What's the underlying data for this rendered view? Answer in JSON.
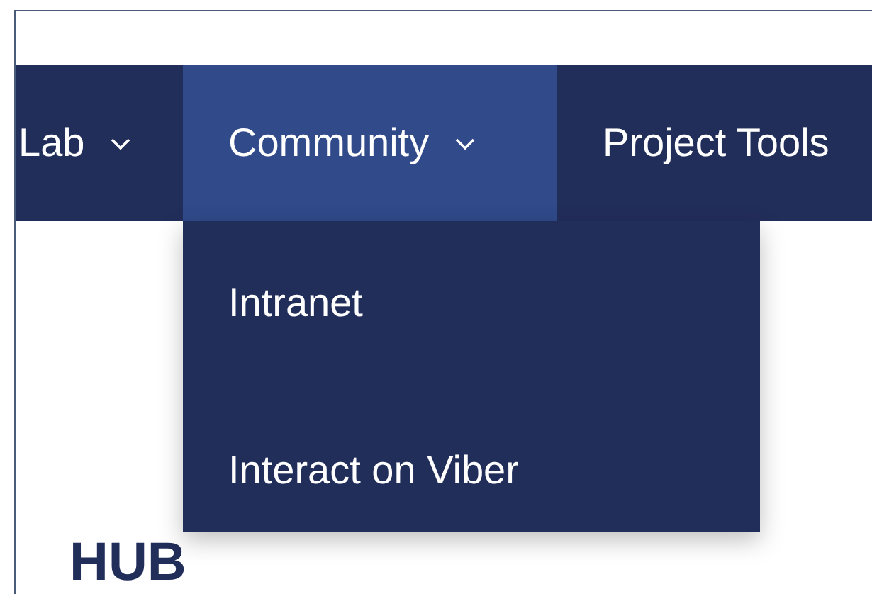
{
  "nav": {
    "items": [
      {
        "label": "Lab",
        "kind": "dropdown",
        "selected": false
      },
      {
        "label": "Community",
        "kind": "dropdown",
        "selected": true,
        "children": [
          {
            "label": "Intranet"
          },
          {
            "label": "Interact on Viber"
          }
        ]
      },
      {
        "label": "Project Tools",
        "kind": "link",
        "selected": false
      }
    ]
  },
  "heading": "HUB"
}
